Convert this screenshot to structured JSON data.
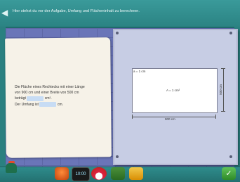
{
  "header": {
    "instruction": "Hier stehst du vor der Aufgabe, Umfang und Flächeninhalt zu berechnen."
  },
  "task": {
    "line1": "Die Fläche eines Rechtecks mit einer Länge",
    "line2": "von 900 cm und einer Breite von 500 cm",
    "line3_prefix": "beträgt",
    "line3_unit": "cm².",
    "line4_prefix": "Der Umfang ist",
    "line4_unit": "cm."
  },
  "board": {
    "corner_label": "a = 1 cm",
    "area_label": "A = 1 cm²",
    "width_label": "900 cm",
    "height_label": "500 cm"
  },
  "toolbar": {
    "clock_text": "10:00",
    "check_label": "✓"
  }
}
